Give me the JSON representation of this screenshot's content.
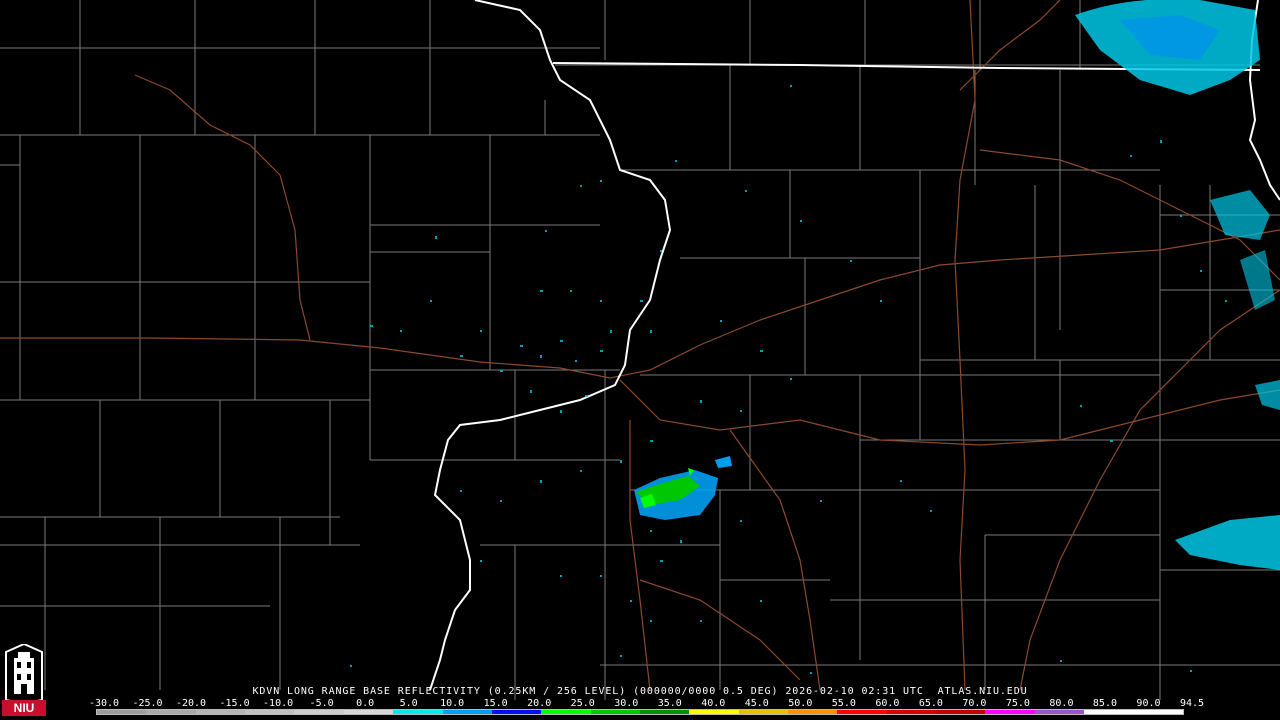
{
  "caption": {
    "station": "KDVN",
    "product": "LONG RANGE BASE REFLECTIVITY (0.25KM / 256 LEVEL) (000000/0000 0.5 DEG)",
    "datetime": "2026-02-10 02:31 UTC",
    "source": "ATLAS.NIU.EDU"
  },
  "logo": {
    "text": "NIU",
    "icon": "niu-tower-logo-icon"
  },
  "legend": {
    "ticks": [
      "-30.0",
      "-25.0",
      "-20.0",
      "-15.0",
      "-10.0",
      "-5.0",
      "0.0",
      "5.0",
      "10.0",
      "15.0",
      "20.0",
      "25.0",
      "30.0",
      "35.0",
      "40.0",
      "45.0",
      "50.0",
      "55.0",
      "60.0",
      "65.0",
      "70.0",
      "75.0",
      "80.0",
      "85.0",
      "90.0",
      "94.5"
    ],
    "colors": [
      "#9c9c9c",
      "#a8a8a8",
      "#b4b4b4",
      "#c0c0c0",
      "#cccccc",
      "#d8d8d8",
      "#05e8e8",
      "#009ef0",
      "#0010f2",
      "#00ff00",
      "#00c800",
      "#009000",
      "#ffff00",
      "#e7c000",
      "#ff9000",
      "#ff0000",
      "#d60000",
      "#c00000",
      "#ff00ff",
      "#9955c9",
      "#ffffff",
      "#ffffff"
    ]
  },
  "colors": {
    "background": "#000000",
    "county_lines": "#7a7a7a",
    "state_lines": "#ffffff",
    "roads": "#8b4a2b",
    "echo_light": "#00e8e8",
    "echo_medium": "#009ef0",
    "echo_heavy": "#00c800"
  }
}
